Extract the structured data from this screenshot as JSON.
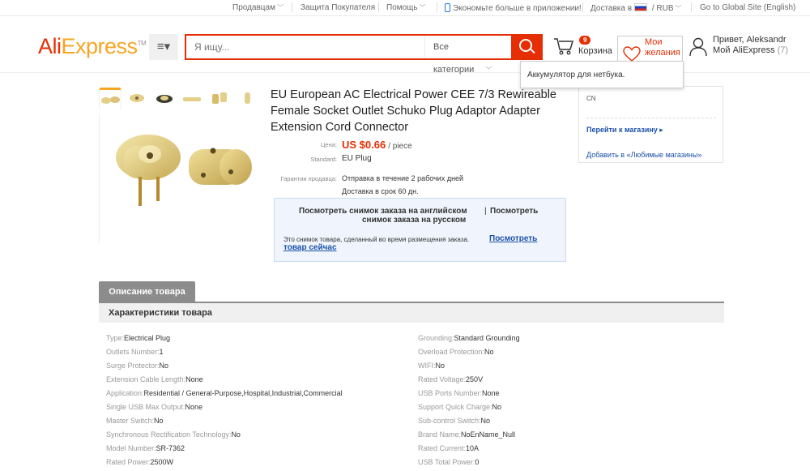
{
  "topbar": {
    "sellers": "Продавцам",
    "buyer_protection": "Защита Покупателя",
    "help": "Помощь",
    "app": "Экономьте больше в приложении!",
    "ship_to": "Доставка в",
    "currency": "RUB",
    "global_site": "Go to Global Site (English)"
  },
  "header": {
    "logo_ali": "Ali",
    "logo_express": "Express",
    "logo_tm": "TM",
    "menu_label": "≡▾",
    "search_placeholder": "Я ищу...",
    "search_category": "Все категории",
    "cart_count": "9",
    "cart_label": "Корзина",
    "wishlist_line1": "Мои",
    "wishlist_line2": "желания",
    "greeting": "Привет, Aleksandr",
    "my_account": "Мой AliExpress",
    "my_account_count": "(7)"
  },
  "wishlist_popup": "Аккумулятор для нетбука.",
  "product": {
    "title": "EU European AC Electrical Power CEE 7/3 Rewireable Female Socket Outlet Schuko Plug Adaptor Adapter Extension Cord Connector",
    "price_label": "Цена:",
    "price": "US $0.66",
    "price_unit": "/ piece",
    "standard_label": "Standard:",
    "standard_value": "EU Plug",
    "guarantee_label": "Гарантии продавца:",
    "guarantee_ship": "Отправка в течение 2 рабочих дней",
    "guarantee_delivery": "Доставка в срок 60 дн."
  },
  "snapshot": {
    "view_en": "Посмотреть снимок заказа на английском",
    "pipe": "|",
    "view_ru_line1": "Посмотреть",
    "view_ru_line2": "снимок заказа на русском",
    "note": "Это снимок товара, сделанный во время размещения заказа.",
    "view_now_line1": "Посмотреть",
    "view_now_line2": "товар сейчас"
  },
  "store": {
    "country": "CN",
    "go_to_store": "Перейти к магазину ▸",
    "add_favorite": "Добавить в «Любимые магазины»"
  },
  "description": {
    "tab_label": "Описание товара",
    "specs_title": "Характеристики товара",
    "specs_left": [
      {
        "k": "Type:",
        "v": "Electrical Plug"
      },
      {
        "k": "Outlets Number:",
        "v": "1"
      },
      {
        "k": "Surge Protector:",
        "v": "No"
      },
      {
        "k": "Extension Cable Length:",
        "v": "None"
      },
      {
        "k": "Application:",
        "v": "Residential / General-Purpose,Hospital,Industrial,Commercial"
      },
      {
        "k": "Single USB Max Output:",
        "v": "None"
      },
      {
        "k": "Master Switch:",
        "v": "No"
      },
      {
        "k": "Synchronous Rectification Technology:",
        "v": "No"
      },
      {
        "k": "Model Number:",
        "v": "SR-7362"
      },
      {
        "k": "Rated Power:",
        "v": "2500W"
      }
    ],
    "specs_right": [
      {
        "k": "Grounding:",
        "v": "Standard Grounding"
      },
      {
        "k": "Overload Protection:",
        "v": "No"
      },
      {
        "k": "WIFI:",
        "v": "No"
      },
      {
        "k": "Rated Voltage:",
        "v": "250V"
      },
      {
        "k": "USB Ports Number:",
        "v": "None"
      },
      {
        "k": "Support Quick Charge:",
        "v": "No"
      },
      {
        "k": "Sub-control Switch:",
        "v": "No"
      },
      {
        "k": "Brand Name:",
        "v": "NoEnName_Null"
      },
      {
        "k": "Rated Current:",
        "v": "10A"
      },
      {
        "k": "USB Total Power:",
        "v": "0"
      }
    ]
  },
  "colors": {
    "brand": "#e62e04",
    "accent": "#f5a623",
    "link": "#1a4fa8"
  }
}
